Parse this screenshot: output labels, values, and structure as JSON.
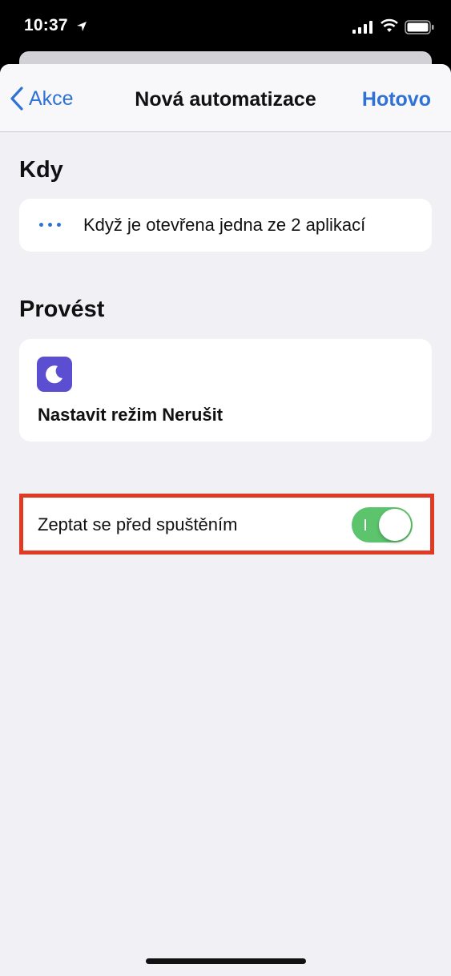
{
  "status_bar": {
    "time": "10:37",
    "icons": [
      "location-arrow-icon",
      "cellular-signal-icon",
      "wifi-icon",
      "battery-icon"
    ]
  },
  "nav": {
    "back_label": "Akce",
    "title": "Nová automatizace",
    "done_label": "Hotovo"
  },
  "when_section": {
    "title": "Kdy",
    "trigger_text": "Když je otevřena jedna ze 2 aplikací"
  },
  "do_section": {
    "title": "Provést",
    "action_label": "Nastavit režim Nerušit",
    "action_icon": "moon-icon"
  },
  "ask_before_running": {
    "label": "Zeptat se před spuštěním",
    "enabled": true
  },
  "colors": {
    "accent": "#2f72d6",
    "toggle_on": "#5cc46c",
    "highlight": "#e03a24",
    "moon_bg": "#5b4ed0"
  }
}
